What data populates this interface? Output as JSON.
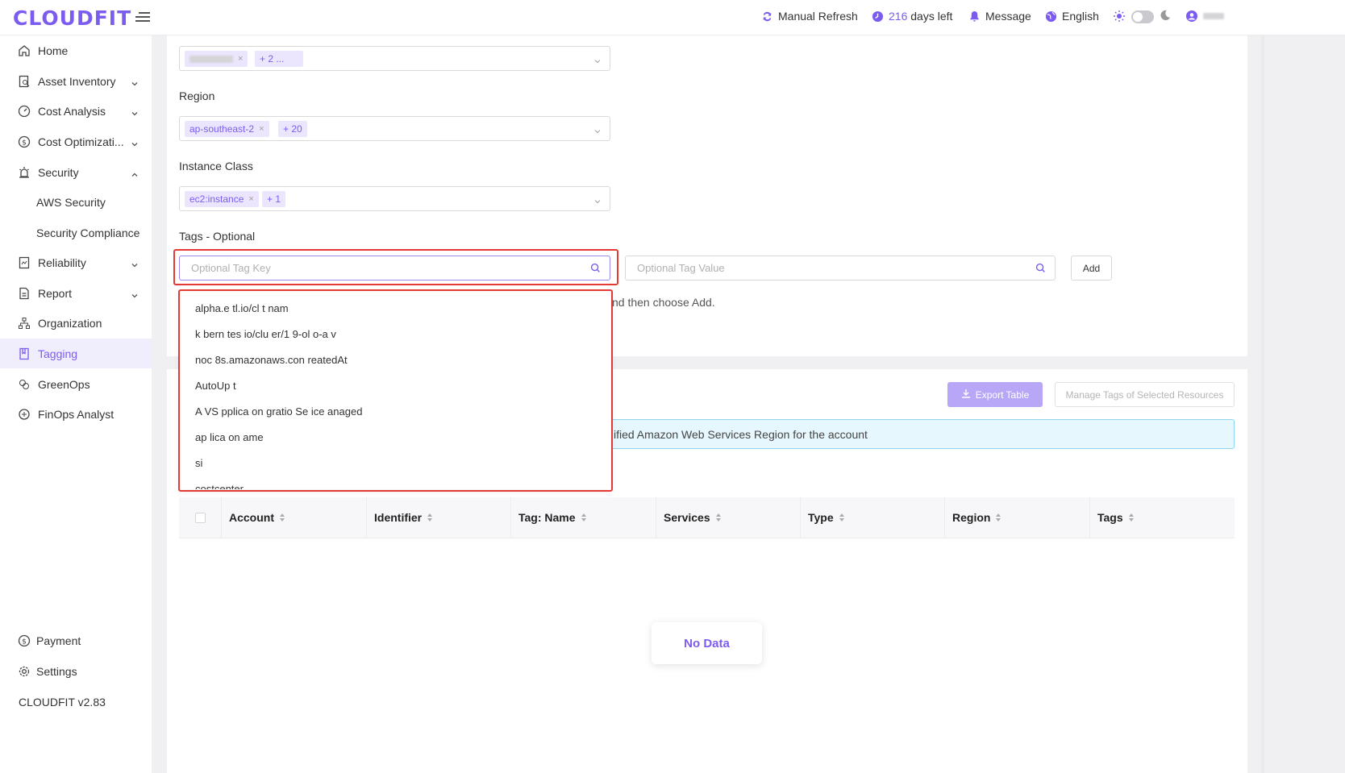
{
  "app": {
    "logo": "CLOUDFIT",
    "version": "CLOUDFIT v2.83"
  },
  "header": {
    "refresh": "Manual Refresh",
    "days_left_count": "216",
    "days_left_suffix": " days left",
    "message": "Message",
    "language": "English"
  },
  "sidebar": {
    "items": [
      {
        "label": "Home",
        "icon": "home-icon"
      },
      {
        "label": "Asset Inventory",
        "icon": "inventory-icon"
      },
      {
        "label": "Cost Analysis",
        "icon": "dashboard-icon"
      },
      {
        "label": "Cost Optimizati...",
        "icon": "dollar-icon"
      },
      {
        "label": "Security",
        "icon": "alarm-icon"
      },
      {
        "label": "AWS Security"
      },
      {
        "label": "Security Compliance"
      },
      {
        "label": "Reliability",
        "icon": "reliability-icon"
      },
      {
        "label": "Report",
        "icon": "report-icon"
      },
      {
        "label": "Organization",
        "icon": "org-icon"
      },
      {
        "label": "Tagging",
        "icon": "tag-icon"
      },
      {
        "label": "GreenOps",
        "icon": "leaf-icon"
      },
      {
        "label": "FinOps Analyst",
        "icon": "analyst-icon"
      }
    ],
    "bottom": [
      {
        "label": "Payment",
        "icon": "dollar-icon"
      },
      {
        "label": "Settings",
        "icon": "gear-icon"
      }
    ]
  },
  "form": {
    "account_more": "+ 2 ...",
    "region_label": "Region",
    "region_tag": "ap-southeast-2",
    "region_more": "+ 20",
    "instance_label": "Instance Class",
    "instance_tag": "ec2:instance",
    "instance_more": "+ 1",
    "tags_label": "Tags - Optional",
    "tag_key_placeholder": "Optional Tag Key",
    "tag_value_placeholder": "Optional Tag Value",
    "add_button": "Add",
    "hint": "nd then choose Add."
  },
  "dropdown": {
    "items": [
      "alpha.e  tl.io/cl  t   nam",
      "k bern tes io/clu  er/1  9-ol  o-a  v",
      "noc   8s.amazonaws.con  reatedAt",
      "AutoUp  t",
      "A VS  pplica  on  gratio  Se  ice  anaged",
      "ap  lica  on  ame",
      "si",
      "costcenter"
    ]
  },
  "toolbar": {
    "export": "Export Table",
    "manage": "Manage Tags of Selected Resources",
    "info": "ified Amazon Web Services Region for the account"
  },
  "table": {
    "columns": [
      "Account",
      "Identifier",
      "Tag: Name",
      "Services",
      "Type",
      "Region",
      "Tags"
    ],
    "empty": "No Data"
  },
  "colors": {
    "accent": "#7c5cf0",
    "highlight": "#e53935",
    "info_bg": "#e6f7fd"
  }
}
